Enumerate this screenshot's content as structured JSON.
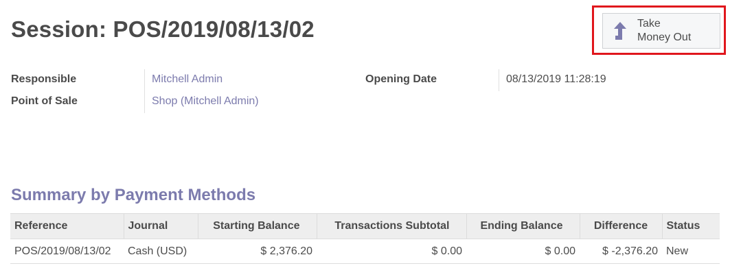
{
  "page": {
    "title": "Session: POS/2019/08/13/02"
  },
  "action_button": {
    "line1": "Take",
    "line2": "Money Out",
    "icon": "arrow-up-icon",
    "icon_color": "#7c7bad",
    "highlight_color": "#e0161c"
  },
  "fields": {
    "responsible_label": "Responsible",
    "responsible_value": "Mitchell Admin",
    "pos_label": "Point of Sale",
    "pos_value": "Shop (Mitchell Admin)",
    "opening_date_label": "Opening Date",
    "opening_date_value": "08/13/2019 11:28:19"
  },
  "summary": {
    "title": "Summary by Payment Methods",
    "columns": [
      "Reference",
      "Journal",
      "Starting Balance",
      "Transactions Subtotal",
      "Ending Balance",
      "Difference",
      "Status"
    ],
    "rows": [
      {
        "reference": "POS/2019/08/13/02",
        "journal": "Cash (USD)",
        "starting_balance": "$ 2,376.20",
        "transactions_subtotal": "$ 0.00",
        "ending_balance": "$ 0.00",
        "difference": "$ -2,376.20",
        "status": "New"
      }
    ]
  },
  "colors": {
    "accent": "#7c7bad",
    "header_bg": "#eeeeee",
    "text": "#4a4a4a"
  }
}
